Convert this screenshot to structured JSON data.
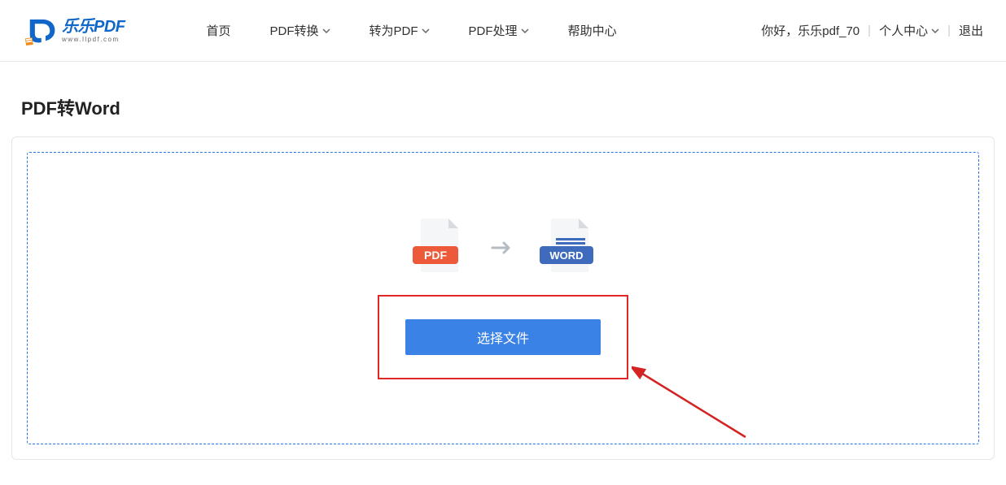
{
  "logo": {
    "main": "乐乐PDF",
    "url": "www.llpdf.com"
  },
  "nav": {
    "home": "首页",
    "pdf_convert": "PDF转换",
    "to_pdf": "转为PDF",
    "pdf_process": "PDF处理",
    "help_center": "帮助中心"
  },
  "user": {
    "greeting": "你好，乐乐pdf_70",
    "profile_center": "个人中心",
    "logout": "退出"
  },
  "page": {
    "title": "PDF转Word",
    "select_file": "选择文件",
    "source_label": "PDF",
    "target_label": "WORD"
  }
}
